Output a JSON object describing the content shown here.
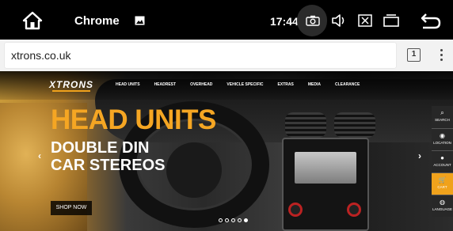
{
  "statusbar": {
    "app_name": "Chrome",
    "time": "17:44",
    "icons": [
      "home-icon",
      "gallery-icon",
      "screenshot-camera-icon",
      "volume-icon",
      "close-window-icon",
      "recent-apps-icon",
      "back-icon"
    ]
  },
  "browser": {
    "url": "xtrons.co.uk",
    "tab_count": "1"
  },
  "site": {
    "logo": "XTRONS",
    "nav": [
      "HEAD UNITS",
      "HEADREST",
      "OVERHEAD",
      "VEHICLE SPECIFIC",
      "EXTRAS",
      "MEDIA",
      "CLEARANCE"
    ],
    "hero_title": "HEAD UNITS",
    "hero_line1": "DOUBLE DIN",
    "hero_line2": "CAR STEREOS",
    "shop_button": "SHOP NOW",
    "arrow_prev": "‹",
    "arrow_next": "›",
    "slide_count": 5,
    "active_slide": 5,
    "side_panel": [
      {
        "label": "SEARCH",
        "icon": "search-icon"
      },
      {
        "label": "LOCATION",
        "icon": "location-icon"
      },
      {
        "label": "ACCOUNT",
        "icon": "account-icon"
      },
      {
        "label": "CART",
        "icon": "cart-icon"
      },
      {
        "label": "LANGUAGE",
        "icon": "globe-icon"
      }
    ]
  },
  "colors": {
    "accent": "#f0a21c",
    "hero_title": "#f5a623",
    "statusbar": "#000000",
    "toolbar": "#f2f2f2"
  }
}
